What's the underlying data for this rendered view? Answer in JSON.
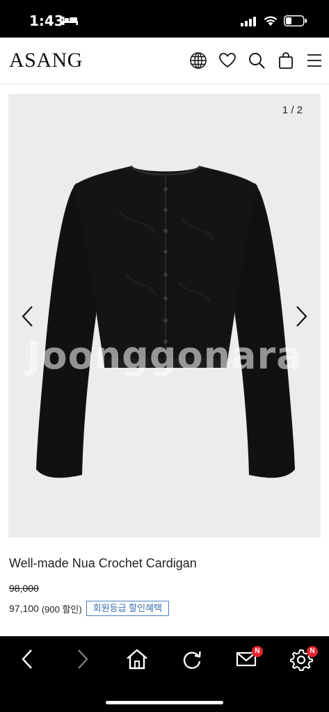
{
  "status_bar": {
    "time": "1:43",
    "icons": [
      "bed-icon",
      "signal-icon",
      "wifi-icon",
      "battery-icon"
    ]
  },
  "header": {
    "logo": "ASANG",
    "icons": [
      "globe-icon",
      "heart-icon",
      "search-icon",
      "shopping-bag-icon",
      "menu-icon"
    ]
  },
  "gallery": {
    "counter": "1 / 2",
    "watermark": "Joonggonara",
    "icons": [
      "chevron-left-icon",
      "chevron-right-icon"
    ]
  },
  "product": {
    "name": "Well-made Nua Crochet Cardigan",
    "original_price": "98,000",
    "sale_price": "97,100",
    "discount": "(900 할인)",
    "benefit_button": "회원등급 할인혜택"
  },
  "bottom_nav": {
    "icons": [
      "back-icon",
      "forward-icon",
      "home-icon",
      "refresh-icon",
      "mail-icon",
      "settings-icon"
    ],
    "mail_badge": "N",
    "settings_badge": "N"
  },
  "colors": {
    "accent": "#3a6fb0",
    "badge": "#e8242e",
    "gallery_bg": "#ececec"
  }
}
